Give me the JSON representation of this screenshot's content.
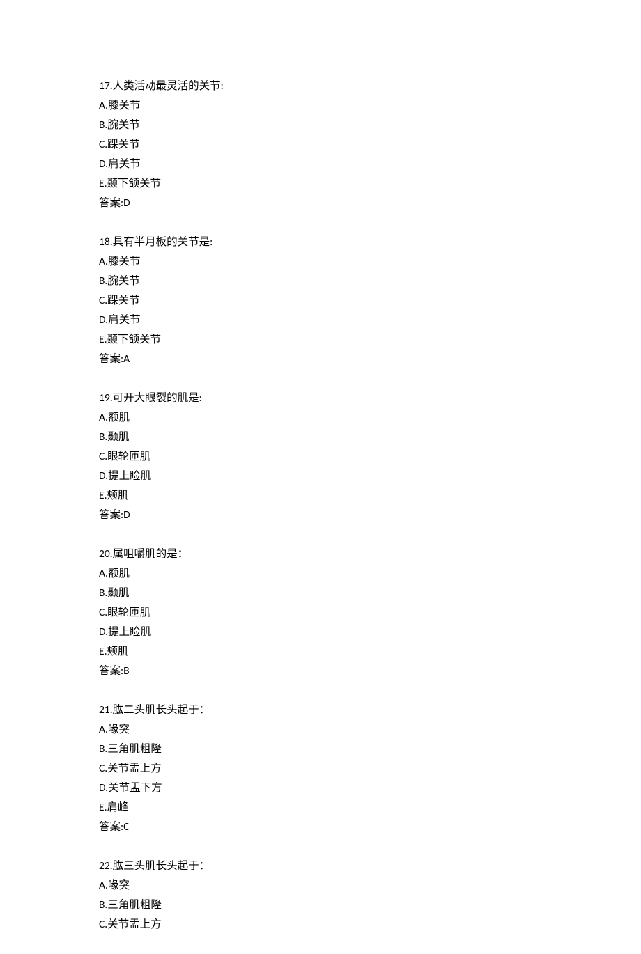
{
  "questions": [
    {
      "number": "17",
      "stem": "17.人类活动最灵活的关节:",
      "options": [
        "A.膝关节",
        "B.腕关节",
        "C.踝关节",
        "D.肩关节",
        "E.颞下颌关节"
      ],
      "answer": "答案:D"
    },
    {
      "number": "18",
      "stem": "18.具有半月板的关节是:",
      "options": [
        "A.膝关节",
        "B.腕关节",
        "C.踝关节",
        "D.肩关节",
        "E.颞下颌关节"
      ],
      "answer": "答案:A"
    },
    {
      "number": "19",
      "stem": "19.可开大眼裂的肌是:",
      "options": [
        "A.额肌",
        "B.颞肌",
        "C.眼轮匝肌",
        "D.提上睑肌",
        "E.颊肌"
      ],
      "answer": "答案:D"
    },
    {
      "number": "20",
      "stem": "20.属咀嚼肌的是：",
      "options": [
        "A.额肌",
        "B.颞肌",
        "C.眼轮匝肌",
        "D.提上睑肌",
        "E.颊肌"
      ],
      "answer": "答案:B"
    },
    {
      "number": "21",
      "stem": "21.肱二头肌长头起于：",
      "options": [
        "A.喙突",
        "B.三角肌粗隆",
        "C.关节盂上方",
        "D.关节盂下方",
        "E.肩峰"
      ],
      "answer": "答案:C"
    },
    {
      "number": "22",
      "stem": "22.肱三头肌长头起于：",
      "options": [
        "A.喙突",
        "B.三角肌粗隆",
        "C.关节盂上方"
      ],
      "answer": null
    }
  ]
}
